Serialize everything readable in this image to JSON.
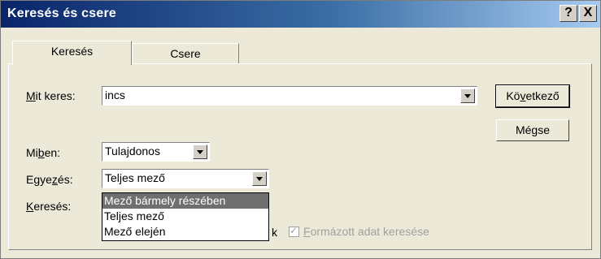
{
  "window": {
    "title": "Keresés és csere",
    "help_glyph": "?",
    "close_glyph": "X"
  },
  "tabs": [
    {
      "label": "Keresés"
    },
    {
      "label": "Csere"
    }
  ],
  "form": {
    "find_label": {
      "mn": "M",
      "rest": "it keres:"
    },
    "find_value": "incs",
    "look_in_label": {
      "a": "Mi",
      "mn": "b",
      "rest": "en:"
    },
    "look_in_value": "Tulajdonos",
    "match_label": {
      "a": "Egye",
      "mn": "z",
      "rest": "és:"
    },
    "match_value": "Teljes mező",
    "search_label": {
      "mn": "K",
      "rest": "eresés:"
    }
  },
  "buttons": {
    "next": {
      "a": "Kö",
      "mn": "v",
      "rest": "etkező"
    },
    "cancel": "Mégse"
  },
  "match_options": [
    "Mező bármely részében",
    "Teljes mező",
    "Mező elején"
  ],
  "selected_option_index": 0,
  "partial_text": "k",
  "format_checkbox": {
    "mn": "F",
    "rest": "ormázott adat keresése",
    "checked": true,
    "disabled": true
  }
}
